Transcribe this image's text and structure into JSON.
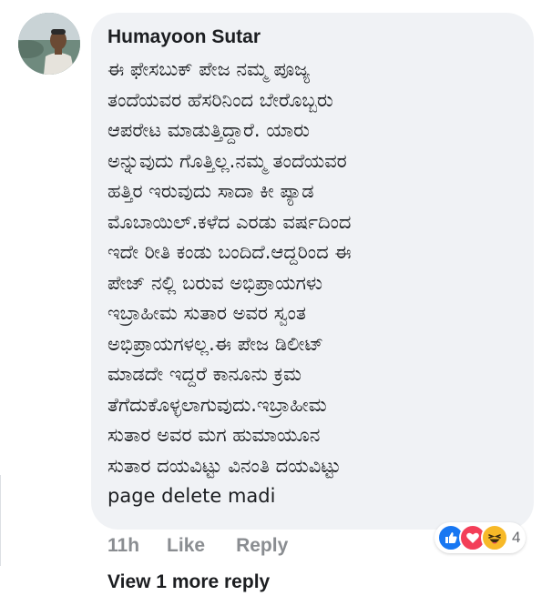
{
  "comment": {
    "author": "Humayoon Sutar",
    "avatar_icon": "profile-photo",
    "body_lines": [
      "ಈ ಫೇಸಬುಕ್ ಪೇಜ ನಮ್ಮ ಪೂಜ್ಯ",
      "ತಂದೆಯವರ ಹೆಸರಿನಿಂದ ಬೇರೊಬ್ಬರು",
      "ಆಪರೇಟ ಮಾಡುತ್ತಿದ್ದಾರೆ. ಯಾರು",
      "ಅನ್ನುವುದು ಗೊತ್ತಿಲ್ಲ.ನಮ್ಮ ತಂದೆಯವರ",
      "ಹತ್ತಿರ ಇರುವುದು ಸಾದಾ ಕೀ ಪ್ಯಾಡ",
      "ಮೊಬಾಯಿಲ್.ಕಳೆದ ಎರಡು ವರ್ಷದಿಂದ",
      "ಇದೇ ರೀತಿ ಕಂಡು ಬಂದಿದೆ.ಆದ್ದರಿಂದ ಈ",
      "ಪೇಜ್ ನಲ್ಲಿ ಬರುವ ಅಭಿಪ್ರಾಯಗಳು",
      "ಇಬ್ರಾಹೀಮ ಸುತಾರ ಅವರ ಸ್ವಂತ",
      "ಅಭಿಪ್ರಾಯಗಳಲ್ಲ.ಈ ಪೇಜ ಡಿಲೀಟ್",
      "ಮಾಡದೇ ಇದ್ದರೆ ಕಾನೂನು ಕ್ರಮ",
      "ತೆಗೆದುಕೊಳ್ಳಲಾಗುವುದು.ಇಬ್ರಾಹೀಮ",
      "ಸುತಾರ ಅವರ ಮಗ  ಹುಮಾಯೂನ",
      "ಸುತಾರ ದಯವಿಟ್ಟು ವಿನಂತಿ ದಯವಿಟ್ಟು",
      "page delete madi"
    ],
    "timestamp": "11h",
    "like_label": "Like",
    "reply_label": "Reply",
    "reactions": {
      "icons": [
        "like-reaction-icon",
        "love-reaction-icon",
        "haha-reaction-icon"
      ],
      "count": "4",
      "colors": {
        "like": "#1877f2",
        "love": "#f33e58",
        "haha": "#f7b928"
      }
    }
  },
  "replies": {
    "view_more_label": "View 1 more reply"
  },
  "colors": {
    "bubble": "#f0f2f5",
    "text": "#1c1e21",
    "muted": "#8a8d91"
  }
}
